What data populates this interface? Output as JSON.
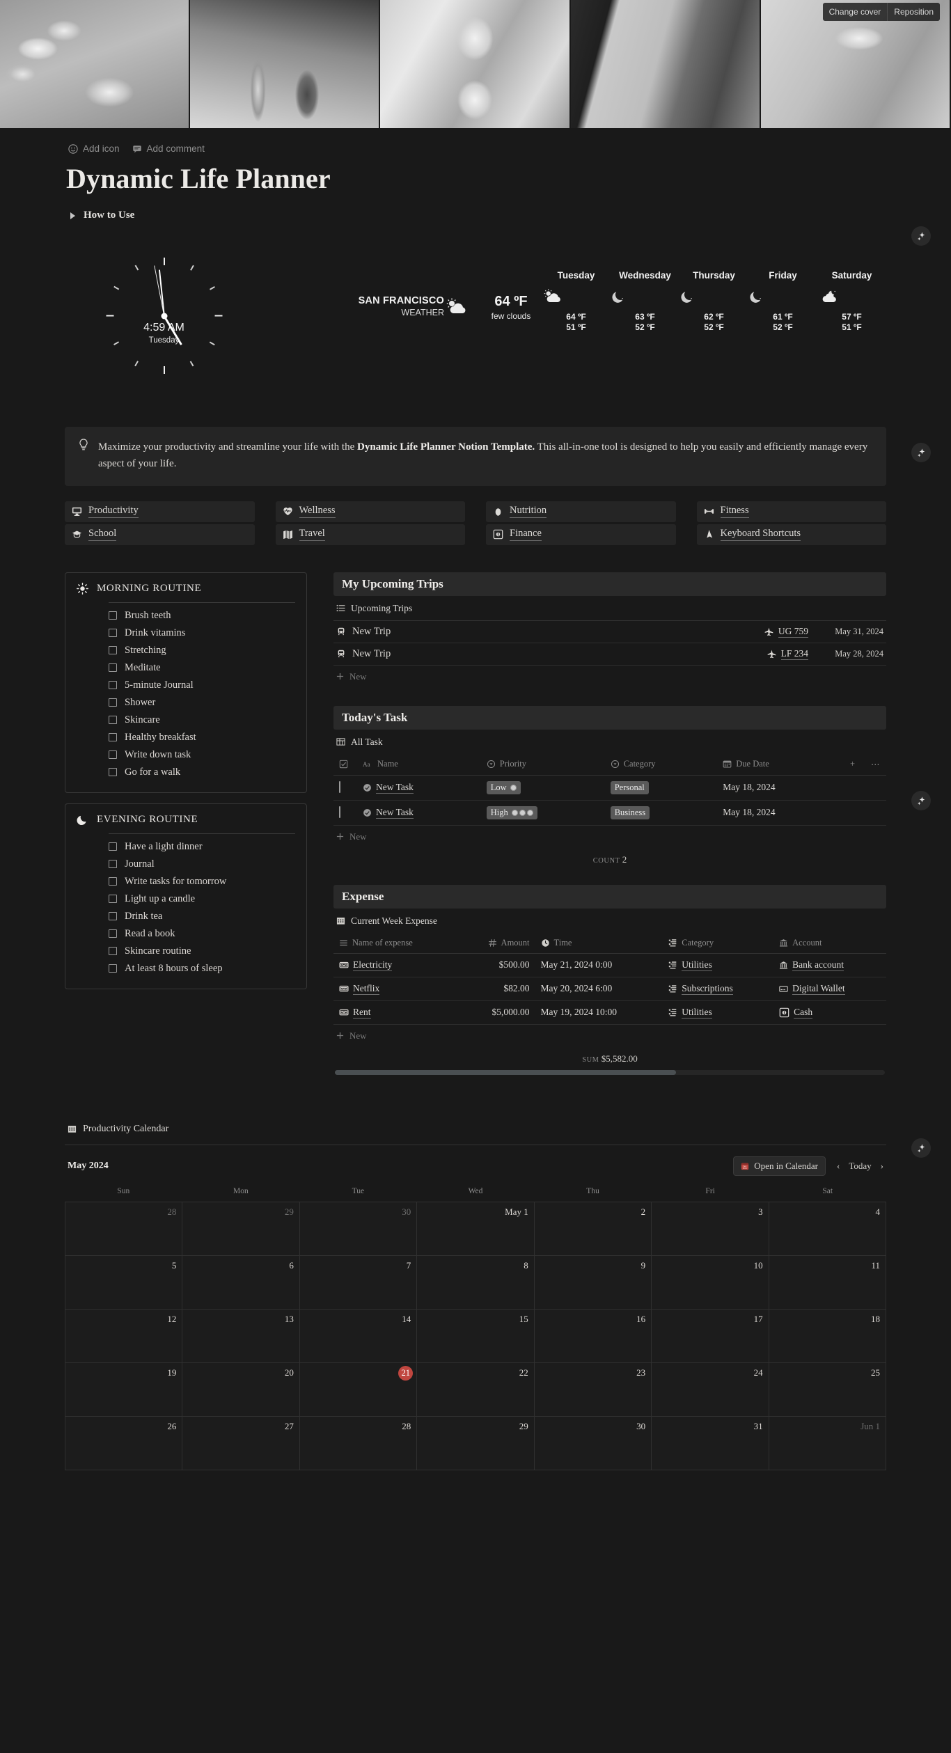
{
  "cover": {
    "change_cover_label": "Change cover",
    "reposition_label": "Reposition"
  },
  "page_meta": {
    "add_icon_label": "Add icon",
    "add_comment_label": "Add comment"
  },
  "header": {
    "title": "Dynamic Life Planner",
    "toggle_label": "How to Use"
  },
  "clock": {
    "time": "4:59 AM",
    "day": "Tuesday",
    "hour_deg": 149,
    "minute_deg": 354,
    "second_deg": 349
  },
  "weather": {
    "city": "SAN FRANCISCO",
    "subtitle": "WEATHER",
    "current_temp": "64 ºF",
    "current_desc": "few clouds",
    "current_icon": "sun-behind-cloud-icon",
    "forecast": [
      {
        "day": "Tuesday",
        "icon": "sun-behind-cloud-icon",
        "high": "64 ºF",
        "low": "51 ºF"
      },
      {
        "day": "Wednesday",
        "icon": "crescent-moon-icon",
        "high": "63 ºF",
        "low": "52 ºF"
      },
      {
        "day": "Thursday",
        "icon": "crescent-moon-icon",
        "high": "62 ºF",
        "low": "52 ºF"
      },
      {
        "day": "Friday",
        "icon": "crescent-moon-icon",
        "high": "61 ºF",
        "low": "52 ºF"
      },
      {
        "day": "Saturday",
        "icon": "moon-behind-cloud-icon",
        "high": "57 ºF",
        "low": "51 ºF"
      }
    ]
  },
  "callout": {
    "icon": "lightbulb-icon",
    "text_1": "Maximize your productivity and streamline your life with the ",
    "bold": "Dynamic Life Planner Notion Template.",
    "text_2": " This all-in-one tool is designed to help you easily and efficiently manage every aspect of your life."
  },
  "nav_buttons": [
    {
      "label": "Productivity",
      "icon": "monitor-icon"
    },
    {
      "label": "Wellness",
      "icon": "heart-pulse-icon"
    },
    {
      "label": "Nutrition",
      "icon": "egg-icon"
    },
    {
      "label": "Fitness",
      "icon": "dumbbell-icon"
    },
    {
      "label": "School",
      "icon": "graduation-cap-icon"
    },
    {
      "label": "Travel",
      "icon": "map-icon"
    },
    {
      "label": "Finance",
      "icon": "coin-icon"
    },
    {
      "label": "Keyboard Shortcuts",
      "icon": "cursor-icon"
    }
  ],
  "morning_routine": {
    "icon": "sun-icon",
    "title": "MORNING ROUTINE",
    "items": [
      "Brush teeth",
      "Drink vitamins",
      "Stretching",
      "Meditate",
      "5-minute Journal",
      "Shower",
      "Skincare",
      "Healthy breakfast",
      "Write down task",
      "Go for a walk"
    ]
  },
  "evening_routine": {
    "icon": "moon-icon",
    "title": "EVENING ROUTINE",
    "items": [
      "Have a light dinner",
      "Journal",
      "Write tasks for tomorrow",
      "Light up a candle",
      "Drink tea",
      "Read a book",
      "Skincare routine",
      "At least 8 hours of sleep"
    ]
  },
  "trips": {
    "title": "My Upcoming Trips",
    "view_name": "Upcoming Trips",
    "view_icon": "list-view-icon",
    "add_new_label": "New",
    "rows": [
      {
        "icon": "train-icon",
        "name": "New Trip",
        "flight_icon": "airplane-icon",
        "flight": "UG 759",
        "date": "May 31, 2024"
      },
      {
        "icon": "train-icon",
        "name": "New Trip",
        "flight_icon": "airplane-icon",
        "flight": "LF 234",
        "date": "May 28, 2024"
      }
    ]
  },
  "tasks": {
    "title": "Today's Task",
    "view_name": "All Task",
    "view_icon": "table-view-icon",
    "add_new_label": "New",
    "columns": [
      {
        "label": "Name",
        "icon": "text-type-icon"
      },
      {
        "label": "Priority",
        "icon": "select-type-icon"
      },
      {
        "label": "Category",
        "icon": "select-type-icon"
      },
      {
        "label": "Due Date",
        "icon": "date-type-icon"
      }
    ],
    "rows": [
      {
        "name": "New Task",
        "priority": "Low",
        "priority_dots": 1,
        "category": "Personal",
        "due_date": "May 18, 2024"
      },
      {
        "name": "New Task",
        "priority": "High",
        "priority_dots": 3,
        "category": "Business",
        "due_date": "May 18, 2024"
      }
    ],
    "summary_label": "COUNT",
    "summary_value": "2"
  },
  "expense": {
    "title": "Expense",
    "view_name": "Current Week Expense",
    "view_icon": "calendar-view-icon",
    "add_new_label": "New",
    "columns": [
      {
        "label": "Name of expense",
        "icon": "title-type-icon"
      },
      {
        "label": "Amount",
        "icon": "number-type-icon"
      },
      {
        "label": "Time",
        "icon": "clock-type-icon"
      },
      {
        "label": "Category",
        "icon": "relation-type-icon"
      },
      {
        "label": "Account",
        "icon": "bank-type-icon"
      }
    ],
    "rows": [
      {
        "icon": "wallet-icon",
        "name": "Electricity",
        "amount": "$500.00",
        "time": "May 21, 2024 0:00",
        "category": "Utilities",
        "category_icon": "relation-type-icon",
        "account": "Bank account",
        "account_icon": "bank-icon"
      },
      {
        "icon": "wallet-icon",
        "name": "Netflix",
        "amount": "$82.00",
        "time": "May 20, 2024 6:00",
        "category": "Subscriptions",
        "category_icon": "relation-type-icon",
        "account": "Digital Wallet",
        "account_icon": "card-icon"
      },
      {
        "icon": "wallet-icon",
        "name": "Rent",
        "amount": "$5,000.00",
        "time": "May 19, 2024 10:00",
        "category": "Utilities",
        "category_icon": "relation-type-icon",
        "account": "Cash",
        "account_icon": "coin-icon"
      }
    ],
    "summary_label": "SUM",
    "summary_value": "$5,582.00"
  },
  "calendar": {
    "block_title": "Productivity Calendar",
    "block_icon": "calendar-view-icon",
    "month": "May 2024",
    "open_label": "Open in Calendar",
    "open_icon": "calendar-red-icon",
    "prev_icon": "chevron-left-icon",
    "today_label": "Today",
    "next_icon": "chevron-right-icon",
    "day_names": [
      "Sun",
      "Mon",
      "Tue",
      "Wed",
      "Thu",
      "Fri",
      "Sat"
    ],
    "today_date": 21,
    "today_color": "#c0463f",
    "weeks": [
      [
        {
          "label": "28",
          "out": true
        },
        {
          "label": "29",
          "out": true
        },
        {
          "label": "30",
          "out": true
        },
        {
          "label": "May 1",
          "out": false
        },
        {
          "label": "2",
          "out": false
        },
        {
          "label": "3",
          "out": false
        },
        {
          "label": "4",
          "out": false
        }
      ],
      [
        {
          "label": "5",
          "out": false
        },
        {
          "label": "6",
          "out": false
        },
        {
          "label": "7",
          "out": false
        },
        {
          "label": "8",
          "out": false
        },
        {
          "label": "9",
          "out": false
        },
        {
          "label": "10",
          "out": false
        },
        {
          "label": "11",
          "out": false
        }
      ],
      [
        {
          "label": "12",
          "out": false
        },
        {
          "label": "13",
          "out": false
        },
        {
          "label": "14",
          "out": false
        },
        {
          "label": "15",
          "out": false
        },
        {
          "label": "16",
          "out": false
        },
        {
          "label": "17",
          "out": false
        },
        {
          "label": "18",
          "out": false
        }
      ],
      [
        {
          "label": "19",
          "out": false
        },
        {
          "label": "20",
          "out": false
        },
        {
          "label": "21",
          "out": false,
          "today": true
        },
        {
          "label": "22",
          "out": false
        },
        {
          "label": "23",
          "out": false
        },
        {
          "label": "24",
          "out": false
        },
        {
          "label": "25",
          "out": false
        }
      ],
      [
        {
          "label": "26",
          "out": false
        },
        {
          "label": "27",
          "out": false
        },
        {
          "label": "28",
          "out": false
        },
        {
          "label": "29",
          "out": false
        },
        {
          "label": "30",
          "out": false
        },
        {
          "label": "31",
          "out": false
        },
        {
          "label": "Jun 1",
          "out": true
        }
      ]
    ]
  },
  "ai_buttons": {
    "icon": "ai-sparkle-icon",
    "count": 4
  }
}
